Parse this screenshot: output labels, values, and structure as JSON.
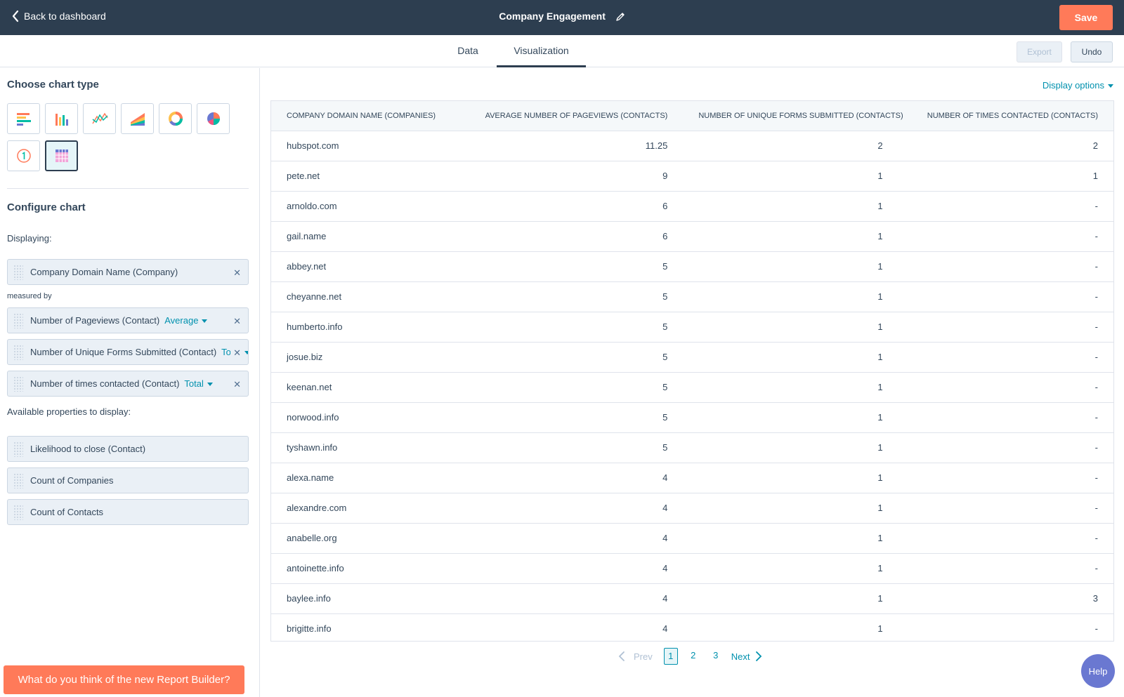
{
  "header": {
    "back_label": "Back to dashboard",
    "title": "Company Engagement",
    "save_label": "Save"
  },
  "tabs": [
    {
      "label": "Data",
      "active": false
    },
    {
      "label": "Visualization",
      "active": true
    }
  ],
  "toolbar": {
    "export_label": "Export",
    "undo_label": "Undo"
  },
  "sidebar": {
    "choose_heading": "Choose chart type",
    "chart_types": [
      {
        "icon": "horizontal-bar-chart-icon",
        "selected": false
      },
      {
        "icon": "vertical-bar-chart-icon",
        "selected": false
      },
      {
        "icon": "line-chart-icon",
        "selected": false
      },
      {
        "icon": "area-chart-icon",
        "selected": false
      },
      {
        "icon": "donut-chart-icon",
        "selected": false
      },
      {
        "icon": "pie-chart-icon",
        "selected": false
      },
      {
        "icon": "kpi-number-icon",
        "selected": false
      },
      {
        "icon": "table-chart-icon",
        "selected": true
      }
    ],
    "configure_heading": "Configure chart",
    "displaying_label": "Displaying:",
    "dimension": {
      "label": "Company Domain Name (Company)"
    },
    "measured_by_label": "measured by",
    "measures": [
      {
        "label": "Number of Pageviews (Contact)",
        "agg": "Average"
      },
      {
        "label": "Number of Unique Forms Submitted (Contact)",
        "agg": "Total"
      },
      {
        "label": "Number of times contacted (Contact)",
        "agg": "Total"
      }
    ],
    "available_label": "Available properties to display:",
    "available": [
      {
        "label": "Likelihood to close (Contact)"
      },
      {
        "label": "Count of Companies"
      },
      {
        "label": "Count of Contacts"
      }
    ],
    "feedback_label": "What do you think of the new Report Builder?"
  },
  "main": {
    "display_options_label": "Display options",
    "columns": [
      "COMPANY DOMAIN NAME (COMPANIES)",
      "AVERAGE NUMBER OF PAGEVIEWS (CONTACTS)",
      "NUMBER OF UNIQUE FORMS SUBMITTED (CONTACTS)",
      "NUMBER OF TIMES CONTACTED (CONTACTS)"
    ],
    "rows": [
      [
        "hubspot.com",
        "11.25",
        "2",
        "2"
      ],
      [
        "pete.net",
        "9",
        "1",
        "1"
      ],
      [
        "arnoldo.com",
        "6",
        "1",
        "-"
      ],
      [
        "gail.name",
        "6",
        "1",
        "-"
      ],
      [
        "abbey.net",
        "5",
        "1",
        "-"
      ],
      [
        "cheyanne.net",
        "5",
        "1",
        "-"
      ],
      [
        "humberto.info",
        "5",
        "1",
        "-"
      ],
      [
        "josue.biz",
        "5",
        "1",
        "-"
      ],
      [
        "keenan.net",
        "5",
        "1",
        "-"
      ],
      [
        "norwood.info",
        "5",
        "1",
        "-"
      ],
      [
        "tyshawn.info",
        "5",
        "1",
        "-"
      ],
      [
        "alexa.name",
        "4",
        "1",
        "-"
      ],
      [
        "alexandre.com",
        "4",
        "1",
        "-"
      ],
      [
        "anabelle.org",
        "4",
        "1",
        "-"
      ],
      [
        "antoinette.info",
        "4",
        "1",
        "-"
      ],
      [
        "baylee.info",
        "4",
        "1",
        "3"
      ],
      [
        "brigitte.info",
        "4",
        "1",
        "-"
      ]
    ],
    "pagination": {
      "prev_label": "Prev",
      "pages": [
        "1",
        "2",
        "3"
      ],
      "current_page": "1",
      "next_label": "Next"
    }
  },
  "help_label": "Help",
  "colors": {
    "topbar": "#2d3e50",
    "accent_orange": "#ff7a59",
    "link_teal": "#0091ae",
    "pill_bg": "#eaf0f6"
  }
}
